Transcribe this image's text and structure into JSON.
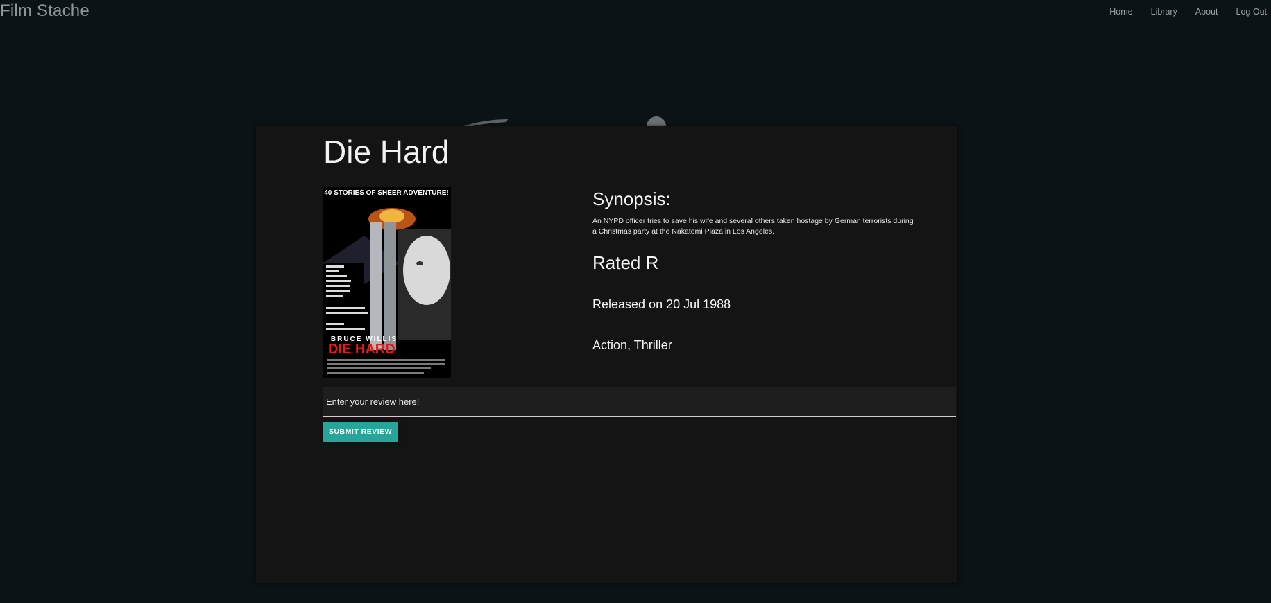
{
  "nav": {
    "brand": "Film Stache",
    "links": [
      "Home",
      "Library",
      "About",
      "Log Out"
    ]
  },
  "movie": {
    "title": "Die Hard",
    "poster": {
      "tagline": "40 STORIES OF SHEER ADVENTURE!",
      "actor": "BRUCE WILLIS",
      "title": "DIE HARD"
    },
    "synopsis_heading": "Synopsis:",
    "synopsis": "An NYPD officer tries to save his wife and several others taken hostage by German terrorists during a Christmas party at the Nakatomi Plaza in Los Angeles.",
    "rating": "Rated R",
    "released": "Released on 20 Jul 1988",
    "genres": "Action, Thriller"
  },
  "review": {
    "placeholder": "Enter your review here!",
    "submit_label": "SUBMIT REVIEW"
  },
  "colors": {
    "background": "#0b1317",
    "card": "#141414",
    "accent": "#26a69a",
    "poster_title": "#e41b17"
  }
}
